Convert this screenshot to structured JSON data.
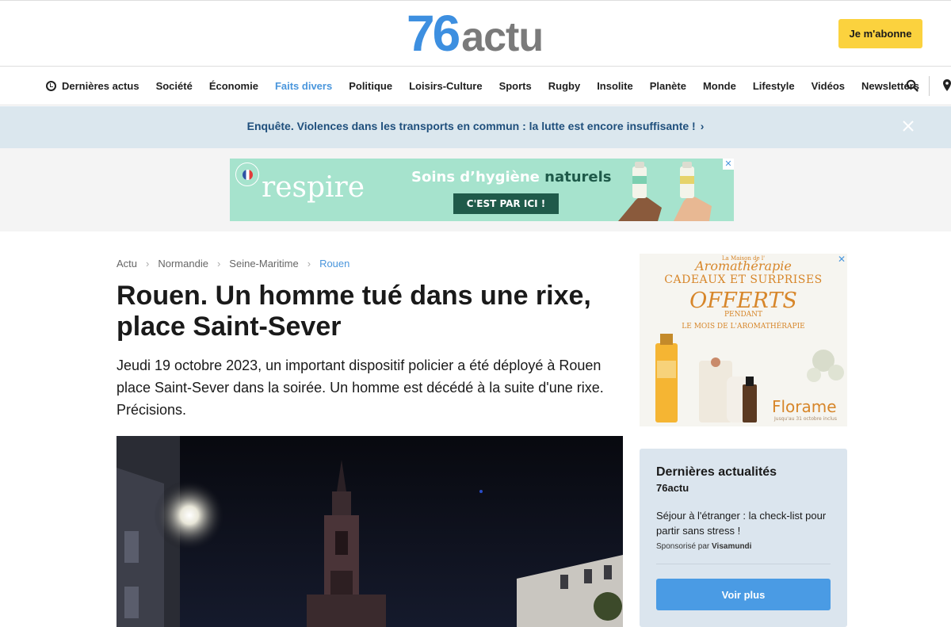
{
  "header": {
    "logo_number": "76",
    "logo_word": "actu",
    "subscribe_label": "Je m'abonne"
  },
  "nav": {
    "items": [
      {
        "label": "Dernières actus",
        "icon": "clock-icon"
      },
      {
        "label": "Société"
      },
      {
        "label": "Économie"
      },
      {
        "label": "Faits divers",
        "active": true
      },
      {
        "label": "Politique"
      },
      {
        "label": "Loisirs-Culture"
      },
      {
        "label": "Sports"
      },
      {
        "label": "Rugby"
      },
      {
        "label": "Insolite"
      },
      {
        "label": "Planète"
      },
      {
        "label": "Monde"
      },
      {
        "label": "Lifestyle"
      },
      {
        "label": "Vidéos"
      },
      {
        "label": "Newsletters"
      }
    ],
    "active_color": "#4a96dc"
  },
  "alert": {
    "text": "Enquête. Violences dans les transports en commun : la lutte est encore insuffisante !",
    "chevron": "›"
  },
  "ad_banner": {
    "badge_text": "MADE IN FRANCE",
    "brand": "respire",
    "headline_plain": "Soins d’hygiène ",
    "headline_bold": "naturels",
    "cta": "C'EST PAR ICI !"
  },
  "breadcrumb": {
    "items": [
      "Actu",
      "Normandie",
      "Seine-Maritime",
      "Rouen"
    ],
    "separator": "›"
  },
  "article": {
    "title": "Rouen. Un homme tué dans une rixe, place Saint-Sever",
    "lead": "Jeudi 19 octobre 2023, un important dispositif policier a été déployé à Rouen place Saint-Sever dans la soirée. Un homme est décédé à la suite d'une rixe. Précisions."
  },
  "side_ad": {
    "small": "La Maison de l'",
    "brand": "Aromathérapie",
    "line1": "CADEAUX ET SURPRISES",
    "line2": "OFFERTS",
    "line3": "PENDANT",
    "line4": "LE MOIS DE L'AROMATHÉRAPIE",
    "florame": "Florame",
    "until": "Jusqu'au 31 octobre inclus"
  },
  "news_box": {
    "title": "Dernières actualités",
    "source": "76actu",
    "item": "Séjour à l'étranger : la check-list pour partir sans stress !",
    "sponsored_prefix": "Sponsorisé par ",
    "sponsor": "Visamundi",
    "more_label": "Voir plus"
  },
  "colors": {
    "accent": "#4a96dc",
    "subscribe": "#fbd23e",
    "alert_bg": "#dbe7ee",
    "alert_text": "#1f4f7c",
    "ad_green": "#a6e3cd"
  }
}
